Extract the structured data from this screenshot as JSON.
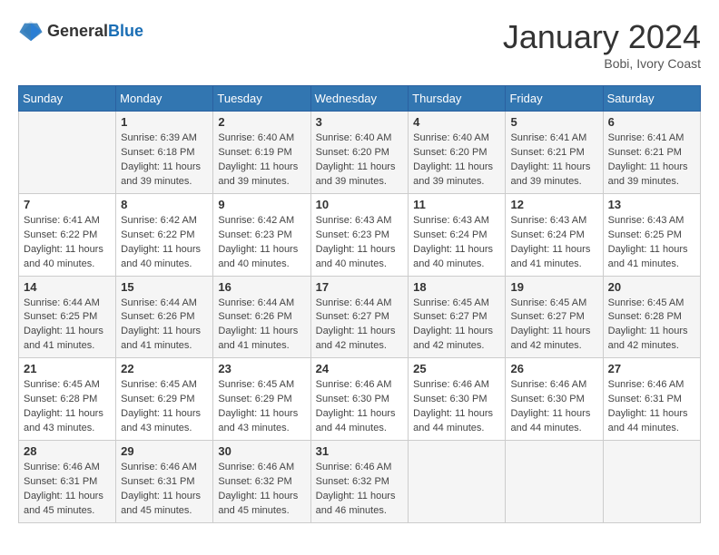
{
  "header": {
    "logo": {
      "text_general": "General",
      "text_blue": "Blue"
    },
    "title": "January 2024",
    "location": "Bobi, Ivory Coast"
  },
  "weekdays": [
    "Sunday",
    "Monday",
    "Tuesday",
    "Wednesday",
    "Thursday",
    "Friday",
    "Saturday"
  ],
  "weeks": [
    [
      {
        "day": "",
        "sunrise": "",
        "sunset": "",
        "daylight": ""
      },
      {
        "day": "1",
        "sunrise": "Sunrise: 6:39 AM",
        "sunset": "Sunset: 6:18 PM",
        "daylight": "Daylight: 11 hours and 39 minutes."
      },
      {
        "day": "2",
        "sunrise": "Sunrise: 6:40 AM",
        "sunset": "Sunset: 6:19 PM",
        "daylight": "Daylight: 11 hours and 39 minutes."
      },
      {
        "day": "3",
        "sunrise": "Sunrise: 6:40 AM",
        "sunset": "Sunset: 6:20 PM",
        "daylight": "Daylight: 11 hours and 39 minutes."
      },
      {
        "day": "4",
        "sunrise": "Sunrise: 6:40 AM",
        "sunset": "Sunset: 6:20 PM",
        "daylight": "Daylight: 11 hours and 39 minutes."
      },
      {
        "day": "5",
        "sunrise": "Sunrise: 6:41 AM",
        "sunset": "Sunset: 6:21 PM",
        "daylight": "Daylight: 11 hours and 39 minutes."
      },
      {
        "day": "6",
        "sunrise": "Sunrise: 6:41 AM",
        "sunset": "Sunset: 6:21 PM",
        "daylight": "Daylight: 11 hours and 39 minutes."
      }
    ],
    [
      {
        "day": "7",
        "sunrise": "Sunrise: 6:41 AM",
        "sunset": "Sunset: 6:22 PM",
        "daylight": "Daylight: 11 hours and 40 minutes."
      },
      {
        "day": "8",
        "sunrise": "Sunrise: 6:42 AM",
        "sunset": "Sunset: 6:22 PM",
        "daylight": "Daylight: 11 hours and 40 minutes."
      },
      {
        "day": "9",
        "sunrise": "Sunrise: 6:42 AM",
        "sunset": "Sunset: 6:23 PM",
        "daylight": "Daylight: 11 hours and 40 minutes."
      },
      {
        "day": "10",
        "sunrise": "Sunrise: 6:43 AM",
        "sunset": "Sunset: 6:23 PM",
        "daylight": "Daylight: 11 hours and 40 minutes."
      },
      {
        "day": "11",
        "sunrise": "Sunrise: 6:43 AM",
        "sunset": "Sunset: 6:24 PM",
        "daylight": "Daylight: 11 hours and 40 minutes."
      },
      {
        "day": "12",
        "sunrise": "Sunrise: 6:43 AM",
        "sunset": "Sunset: 6:24 PM",
        "daylight": "Daylight: 11 hours and 41 minutes."
      },
      {
        "day": "13",
        "sunrise": "Sunrise: 6:43 AM",
        "sunset": "Sunset: 6:25 PM",
        "daylight": "Daylight: 11 hours and 41 minutes."
      }
    ],
    [
      {
        "day": "14",
        "sunrise": "Sunrise: 6:44 AM",
        "sunset": "Sunset: 6:25 PM",
        "daylight": "Daylight: 11 hours and 41 minutes."
      },
      {
        "day": "15",
        "sunrise": "Sunrise: 6:44 AM",
        "sunset": "Sunset: 6:26 PM",
        "daylight": "Daylight: 11 hours and 41 minutes."
      },
      {
        "day": "16",
        "sunrise": "Sunrise: 6:44 AM",
        "sunset": "Sunset: 6:26 PM",
        "daylight": "Daylight: 11 hours and 41 minutes."
      },
      {
        "day": "17",
        "sunrise": "Sunrise: 6:44 AM",
        "sunset": "Sunset: 6:27 PM",
        "daylight": "Daylight: 11 hours and 42 minutes."
      },
      {
        "day": "18",
        "sunrise": "Sunrise: 6:45 AM",
        "sunset": "Sunset: 6:27 PM",
        "daylight": "Daylight: 11 hours and 42 minutes."
      },
      {
        "day": "19",
        "sunrise": "Sunrise: 6:45 AM",
        "sunset": "Sunset: 6:27 PM",
        "daylight": "Daylight: 11 hours and 42 minutes."
      },
      {
        "day": "20",
        "sunrise": "Sunrise: 6:45 AM",
        "sunset": "Sunset: 6:28 PM",
        "daylight": "Daylight: 11 hours and 42 minutes."
      }
    ],
    [
      {
        "day": "21",
        "sunrise": "Sunrise: 6:45 AM",
        "sunset": "Sunset: 6:28 PM",
        "daylight": "Daylight: 11 hours and 43 minutes."
      },
      {
        "day": "22",
        "sunrise": "Sunrise: 6:45 AM",
        "sunset": "Sunset: 6:29 PM",
        "daylight": "Daylight: 11 hours and 43 minutes."
      },
      {
        "day": "23",
        "sunrise": "Sunrise: 6:45 AM",
        "sunset": "Sunset: 6:29 PM",
        "daylight": "Daylight: 11 hours and 43 minutes."
      },
      {
        "day": "24",
        "sunrise": "Sunrise: 6:46 AM",
        "sunset": "Sunset: 6:30 PM",
        "daylight": "Daylight: 11 hours and 44 minutes."
      },
      {
        "day": "25",
        "sunrise": "Sunrise: 6:46 AM",
        "sunset": "Sunset: 6:30 PM",
        "daylight": "Daylight: 11 hours and 44 minutes."
      },
      {
        "day": "26",
        "sunrise": "Sunrise: 6:46 AM",
        "sunset": "Sunset: 6:30 PM",
        "daylight": "Daylight: 11 hours and 44 minutes."
      },
      {
        "day": "27",
        "sunrise": "Sunrise: 6:46 AM",
        "sunset": "Sunset: 6:31 PM",
        "daylight": "Daylight: 11 hours and 44 minutes."
      }
    ],
    [
      {
        "day": "28",
        "sunrise": "Sunrise: 6:46 AM",
        "sunset": "Sunset: 6:31 PM",
        "daylight": "Daylight: 11 hours and 45 minutes."
      },
      {
        "day": "29",
        "sunrise": "Sunrise: 6:46 AM",
        "sunset": "Sunset: 6:31 PM",
        "daylight": "Daylight: 11 hours and 45 minutes."
      },
      {
        "day": "30",
        "sunrise": "Sunrise: 6:46 AM",
        "sunset": "Sunset: 6:32 PM",
        "daylight": "Daylight: 11 hours and 45 minutes."
      },
      {
        "day": "31",
        "sunrise": "Sunrise: 6:46 AM",
        "sunset": "Sunset: 6:32 PM",
        "daylight": "Daylight: 11 hours and 46 minutes."
      },
      {
        "day": "",
        "sunrise": "",
        "sunset": "",
        "daylight": ""
      },
      {
        "day": "",
        "sunrise": "",
        "sunset": "",
        "daylight": ""
      },
      {
        "day": "",
        "sunrise": "",
        "sunset": "",
        "daylight": ""
      }
    ]
  ]
}
